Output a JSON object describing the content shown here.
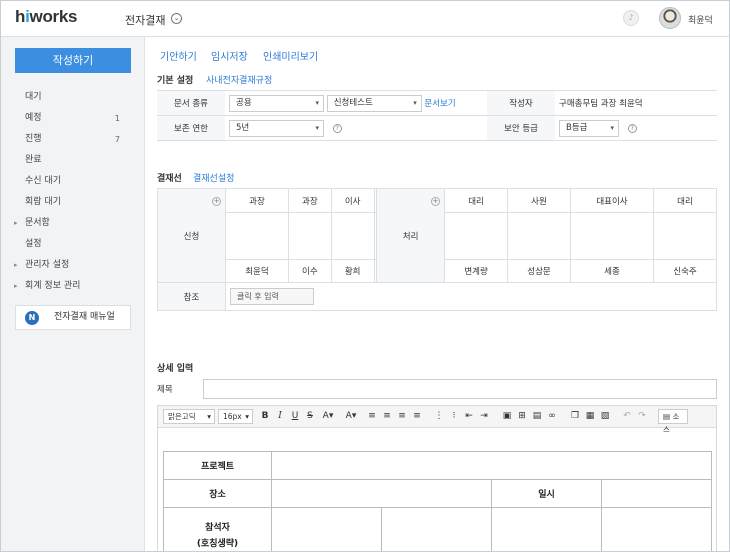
{
  "header": {
    "logo_h": "h",
    "logo_i": "i",
    "logo_rest": "works",
    "app_title": "전자결재",
    "user_name": "최윤덕"
  },
  "sidebar": {
    "write_button": "작성하기",
    "items": [
      {
        "label": "대기",
        "count": ""
      },
      {
        "label": "예정",
        "count": "1"
      },
      {
        "label": "진행",
        "count": "7"
      },
      {
        "label": "완료",
        "count": ""
      },
      {
        "label": "수신 대기",
        "count": ""
      },
      {
        "label": "회람 대기",
        "count": ""
      },
      {
        "label": "문서함",
        "count": ""
      },
      {
        "label": "설정",
        "count": ""
      },
      {
        "label": "관리자 설정",
        "count": ""
      },
      {
        "label": "회계 정보 관리",
        "count": ""
      }
    ],
    "manual_badge": "N",
    "manual_label": "전자결재 매뉴얼"
  },
  "toplinks": {
    "draft": "기안하기",
    "temp_save": "임시저장",
    "print_preview": "인쇄미리보기"
  },
  "basic": {
    "title": "기본 설정",
    "rules_link": "사내전자결재규정",
    "doc_type_label": "문서 종류",
    "doc_type_value1": "공용",
    "doc_type_value2": "신청테스트",
    "doc_view_link": "문서보기",
    "author_label": "작성자",
    "author_value": "구매총무팀 과장 최윤덕",
    "retention_label": "보존 연한",
    "retention_value": "5년",
    "security_label": "보안 등급",
    "security_value": "B등급"
  },
  "approval": {
    "title": "결재선",
    "settings_link": "결재선설정",
    "apply_label": "신청",
    "apply_headers": [
      "과장",
      "과장",
      "이사",
      ""
    ],
    "apply_names": [
      "최윤덕",
      "이수",
      "황희",
      ""
    ],
    "process_label": "처리",
    "process_headers": [
      "대리",
      "사원",
      "대표이사",
      "대리"
    ],
    "process_names": [
      "변계량",
      "성삼문",
      "세종",
      "신숙주"
    ],
    "ref_label": "참조",
    "ref_placeholder": "클릭 후 입력"
  },
  "detail": {
    "title": "상세 입력",
    "subject_label": "제목",
    "toolbar": {
      "font": "맑은고딕",
      "size": "16px",
      "source": "소스"
    },
    "table": {
      "project": "프로젝트",
      "place": "장소",
      "datetime": "일시",
      "attendees": "참석자",
      "attendees_note": "(호칭생략)"
    }
  }
}
